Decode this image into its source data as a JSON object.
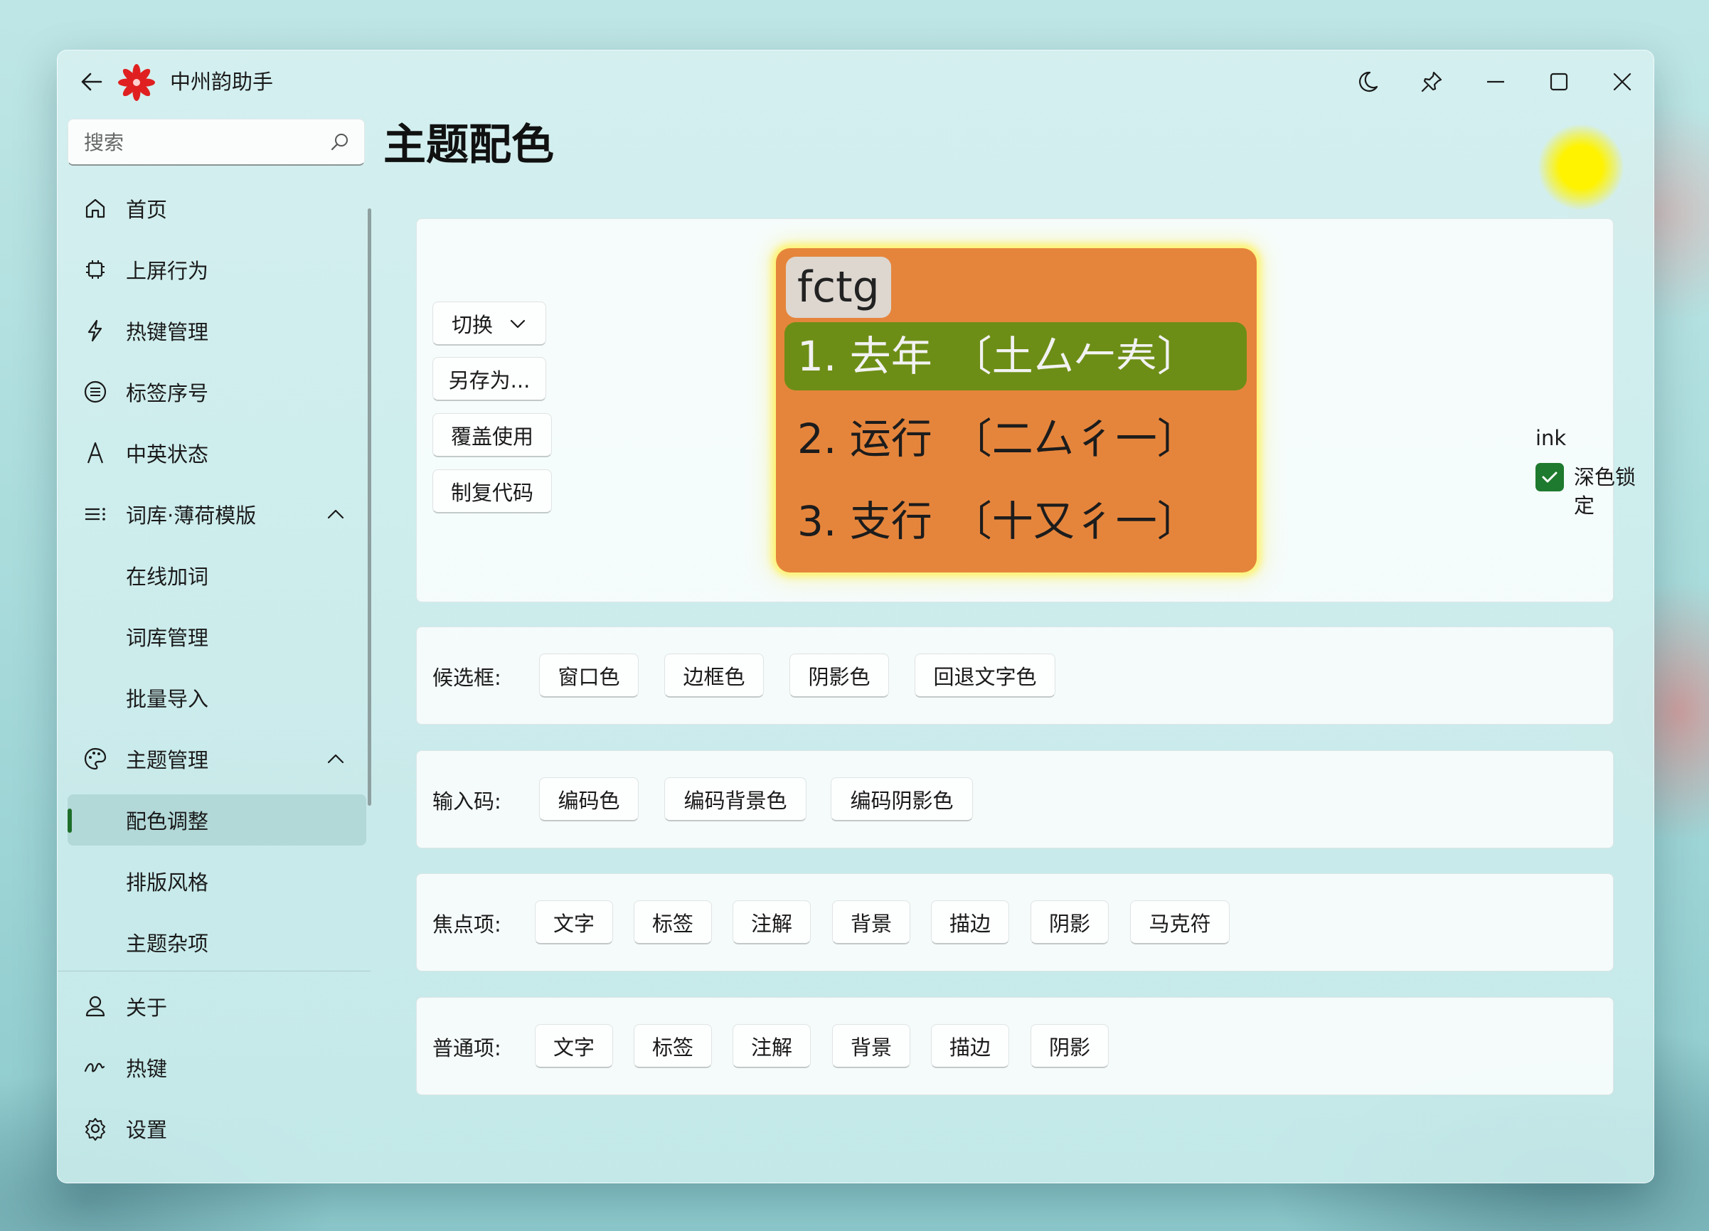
{
  "app": {
    "title": "中州韵助手"
  },
  "titlebar": {
    "back_icon": "arrow-left-icon",
    "theme_icon": "moon-icon",
    "pin_icon": "pin-icon",
    "minimize_icon": "minimize-icon",
    "maximize_icon": "maximize-icon",
    "close_icon": "close-icon"
  },
  "search": {
    "placeholder": "搜索",
    "icon": "search-icon"
  },
  "sidebar": {
    "items": [
      {
        "label": "首页",
        "icon": "home-icon"
      },
      {
        "label": "上屏行为",
        "icon": "chip-icon"
      },
      {
        "label": "热键管理",
        "icon": "lightning-icon"
      },
      {
        "label": "标签序号",
        "icon": "list-circle-icon"
      },
      {
        "label": "中英状态",
        "icon": "letter-a-icon"
      },
      {
        "label": "词库·薄荷模版",
        "icon": "list-icon",
        "expanded": true
      },
      {
        "label": "在线加词"
      },
      {
        "label": "词库管理"
      },
      {
        "label": "批量导入"
      },
      {
        "label": "主题管理",
        "icon": "palette-icon",
        "expanded": true
      },
      {
        "label": "配色调整",
        "selected": true
      },
      {
        "label": "排版风格"
      },
      {
        "label": "主题杂项"
      }
    ],
    "footer": [
      {
        "label": "关于",
        "icon": "person-icon"
      },
      {
        "label": "热键",
        "icon": "gesture-icon"
      },
      {
        "label": "设置",
        "icon": "gear-icon"
      }
    ]
  },
  "page": {
    "title": "主题配色",
    "theme_indicator_color": "#fff300"
  },
  "preview_card": {
    "buttons": {
      "switch": "切换",
      "save_as": "另存为...",
      "override": "覆盖使用",
      "copy_code": "制复代码"
    },
    "preview": {
      "code": "fctg",
      "candidates": [
        {
          "text": "1. 去年",
          "comment": "〔土厶𠂉𡗗〕",
          "highlighted": true
        },
        {
          "text": "2. 运行",
          "comment": "〔二厶彳一〕",
          "highlighted": false
        },
        {
          "text": "3. 支行",
          "comment": "〔十又彳一〕",
          "highlighted": false
        }
      ],
      "colors": {
        "background": "#e5853c",
        "highlight": "#6d8e16",
        "code_bg": "#ddd7d0",
        "border_glow": "#fff050"
      }
    },
    "scheme_name": "ink",
    "dark_lock": {
      "label": "深色锁定",
      "checked": true
    }
  },
  "color_rows": {
    "candidate_box": {
      "label": "候选框:",
      "buttons": [
        "窗口色",
        "边框色",
        "阴影色",
        "回退文字色"
      ]
    },
    "input_code": {
      "label": "输入码:",
      "buttons": [
        "编码色",
        "编码背景色",
        "编码阴影色"
      ]
    },
    "focus_item": {
      "label": "焦点项:",
      "buttons": [
        "文字",
        "标签",
        "注解",
        "背景",
        "描边",
        "阴影",
        "马克符"
      ]
    },
    "normal_item": {
      "label": "普通项:",
      "buttons": [
        "文字",
        "标签",
        "注解",
        "背景",
        "描边",
        "阴影"
      ]
    }
  },
  "accent_color": "#1e7a2e"
}
